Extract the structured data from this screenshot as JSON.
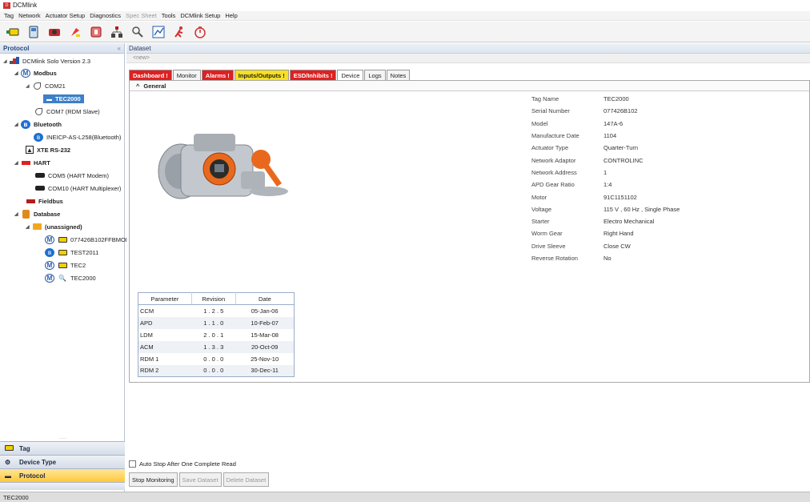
{
  "window": {
    "title": "DCMlink"
  },
  "menu": [
    "Tag",
    "Network",
    "Actuator Setup",
    "Diagnostics",
    "Spec Sheet",
    "Tools",
    "DCMlink Setup",
    "Help"
  ],
  "left_panel": {
    "title": "Protocol",
    "collapse": "«",
    "tree": {
      "root": "DCMlink Solo Version 2.3",
      "modbus": "Modbus",
      "com21": "COM21",
      "tec2000_sel": "TEC2000",
      "com7": "COM7 (RDM Slave)",
      "bluetooth": "Bluetooth",
      "bt_device": "INEICP-AS-L258(Bluetooth)",
      "xte": "XTE RS-232",
      "hart": "HART",
      "com5": "COM5 (HART Modem)",
      "com10": "COM10 (HART Multiplexer)",
      "fieldbus": "Fieldbus",
      "database": "Database",
      "unassigned": "(unassigned)",
      "db1": "077426B102FFBMOD",
      "db2": "TEST2011",
      "db3": "TEC2",
      "db4": "TEC2000"
    },
    "nav": {
      "tag": "Tag",
      "device_type": "Device Type",
      "protocol": "Protocol"
    }
  },
  "dataset": {
    "header": "Dataset",
    "name_placeholder": "<new>",
    "tabs": [
      "Dashboard !",
      "Monitor",
      "Alarms !",
      "Inputs/Outputs !",
      "ESD/Inhibits !",
      "Device",
      "Logs",
      "Notes"
    ],
    "section": "General",
    "param_table": {
      "headers": [
        "Parameter",
        "Revision",
        "Date"
      ],
      "rows": [
        [
          "CCM",
          "1 . 2 . 5",
          "05-Jan-06"
        ],
        [
          "APD",
          "1 . 1 . 0",
          "10-Feb-07"
        ],
        [
          "LDM",
          "2 . 0 . 1",
          "15-Mar-08"
        ],
        [
          "ACM",
          "1 . 3 . 3",
          "20-Oct-09"
        ],
        [
          "RDM 1",
          "0 . 0 . 0",
          "25-Nov-10"
        ],
        [
          "RDM 2",
          "0 . 0 . 0",
          "30-Dec-11"
        ]
      ]
    },
    "properties": [
      [
        "Tag Name",
        "TEC2000"
      ],
      [
        "Serial Number",
        "077426B102"
      ],
      [
        "Model",
        "147A-6"
      ],
      [
        "Manufacture Date",
        "1104"
      ],
      [
        "Actuator Type",
        "Quarter-Turn"
      ],
      [
        "Network Adaptor",
        "CONTROLINC"
      ],
      [
        "Network Address",
        "1"
      ],
      [
        "APD Gear Ratio",
        "1:4"
      ],
      [
        "Motor",
        "91C1151102"
      ],
      [
        "Voltage",
        "115 V ,  60 Hz ,  Single Phase"
      ],
      [
        "Starter",
        "Electro Mechanical"
      ],
      [
        "Worm Gear",
        "Right Hand"
      ],
      [
        "Drive Sleeve",
        "Close CW"
      ],
      [
        "Reverse Rotation",
        "No"
      ]
    ],
    "auto_stop_label": "Auto Stop After One Complete Read",
    "buttons": {
      "stop": "Stop Monitoring",
      "save": "Save Dataset",
      "delete": "Delete Dataset"
    }
  },
  "status_bar": "TEC2000",
  "colors": {
    "tab_red": "#e02020",
    "tab_yellow": "#f7e020",
    "nav_active": "#ffc83a",
    "selection": "#3d7fc8"
  }
}
